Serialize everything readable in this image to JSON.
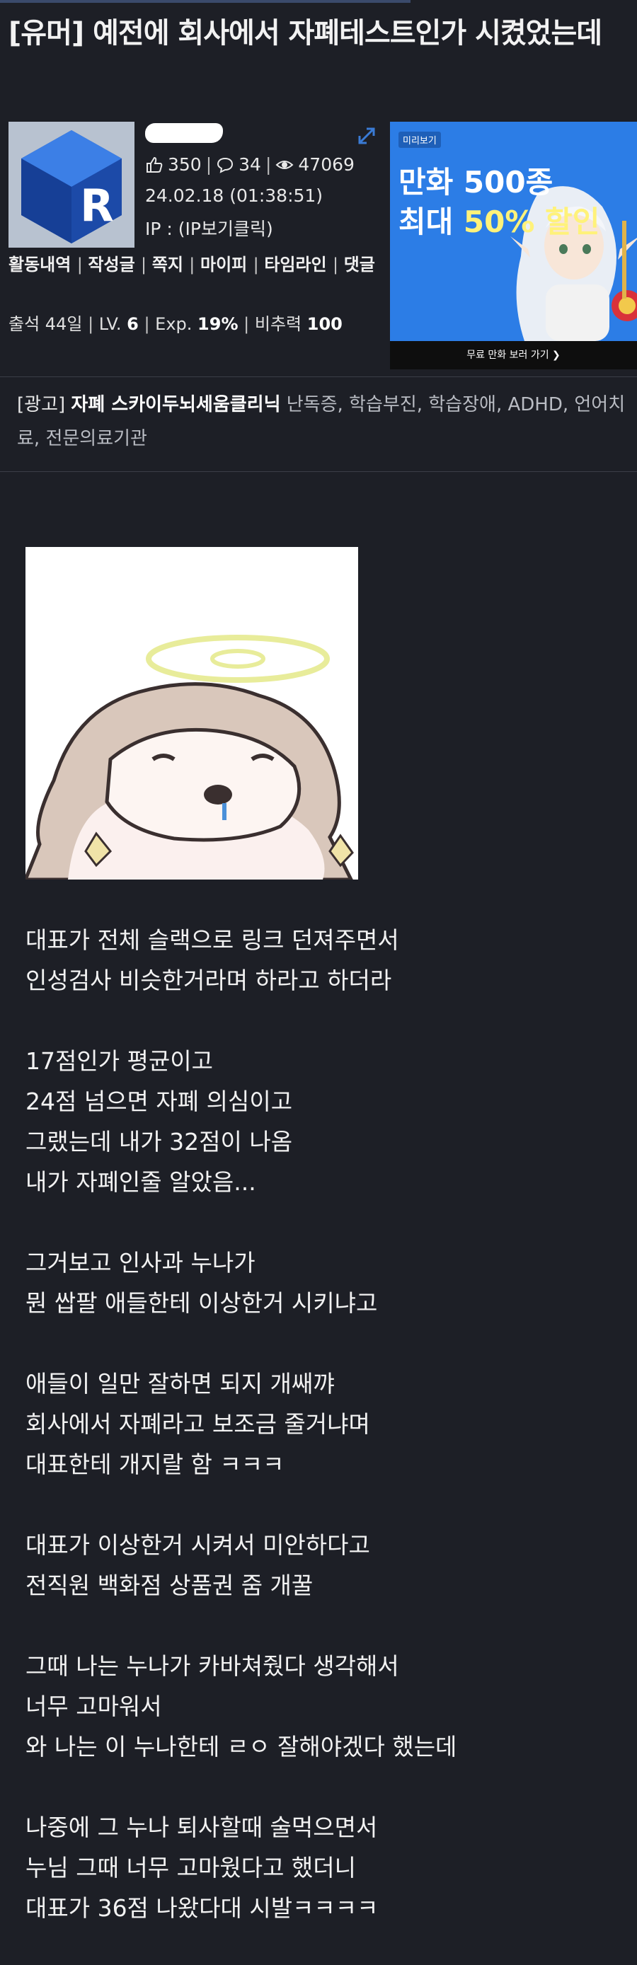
{
  "post": {
    "title": "[유머] 예전에 회사에서 자폐테스트인가 시켰었는데"
  },
  "author": {
    "recommend_count": "350",
    "comment_count": "34",
    "view_count": "47069",
    "datetime": "24.02.18 (01:38:51)",
    "ip_label": "IP : (IP보기클릭)",
    "menu": [
      "활동내역",
      "작성글",
      "쪽지",
      "마이피",
      "타임라인",
      "댓글"
    ],
    "attendance": "출석 44일",
    "level_label": "LV.",
    "level_value": "6",
    "exp_label": "Exp.",
    "exp_value": "19%",
    "recommend_power_label": "비추력",
    "recommend_power_value": "100",
    "avatar_icon": "r-cube-logo-icon"
  },
  "ad": {
    "logo": "미리보기",
    "headline_line1": "만화 500종",
    "headline_line2_prefix": "최대 ",
    "headline_line2_highlight": "50% 할인",
    "footer": "무료 만화 보러 가기 ❯",
    "colors": {
      "background": "#2c7de6",
      "footer": "#0e0e0e"
    }
  },
  "promo": {
    "tag": "[광고]",
    "clinic": "자폐 스카이두뇌세움클리닉",
    "description": "난독증, 학습부진, 학습장애, ADHD, 언어치료, 전문의료기관"
  },
  "body": {
    "paragraphs": [
      [
        "대표가 전체 슬랙으로 링크 던져주면서",
        "인성검사 비슷한거라며 하라고 하더라"
      ],
      [
        "17점인가 평균이고",
        "24점 넘으면 자폐 의심이고",
        "그랬는데 내가 32점이 나옴",
        "내가 자폐인줄 알았음..."
      ],
      [
        "그거보고 인사과 누나가",
        "뭔 쌉팔 애들한테 이상한거 시키냐고"
      ],
      [
        "애들이 일만 잘하면 되지 개쌔꺄",
        "회사에서 자폐라고 보조금 줄거냐며",
        "대표한테 개지랄 함 ㅋㅋㅋ"
      ],
      [
        "대표가 이상한거 시켜서 미안하다고",
        "전직원 백화점 상품권 줌 개꿀"
      ],
      [
        "그때 나는 누나가 카바쳐줬다 생각해서",
        "너무 고마워서",
        "와 나는 이 누나한테 ㄹㅇ 잘해야겠다 했는데"
      ],
      [
        "나중에 그 누나 퇴사할때 술먹으면서",
        "누님 그때 너무 고마웠다고 했더니",
        "대표가 36점 나왔다대 시발ㅋㅋㅋㅋ"
      ]
    ]
  },
  "icons": {
    "recommend": "thumbs-up-icon",
    "comment": "speech-bubble-icon",
    "views": "eye-icon",
    "expand": "expand-arrows-icon"
  },
  "colors": {
    "page_background": "#1d1f26",
    "text": "#f2f2f2",
    "muted": "#b9bcc3"
  }
}
